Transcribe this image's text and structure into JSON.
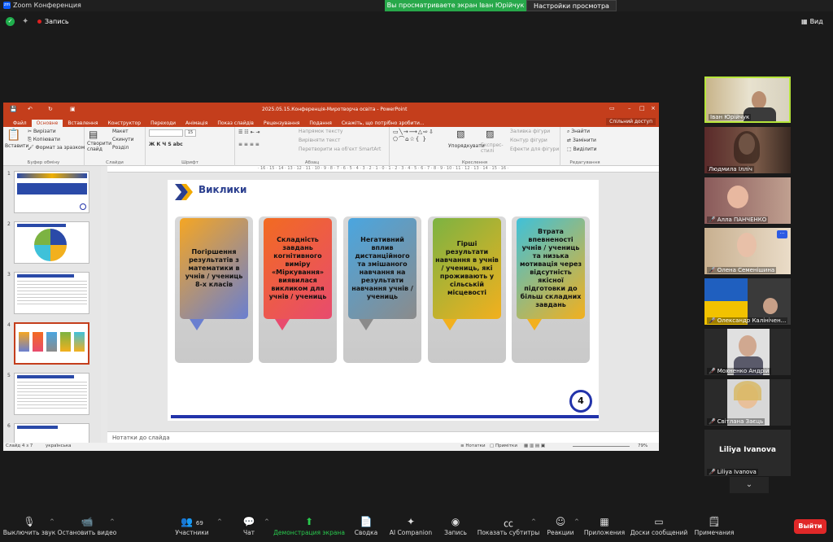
{
  "zoom": {
    "title": "Zoom Конференция",
    "logo_text": "zm",
    "share_banner": "Вы просматриваете экран Іван Юрійчук",
    "view_options": "Настройки просмотра",
    "record_label": "Запись",
    "view_label": "Вид"
  },
  "ppt": {
    "window_title": "2025.05.15.Конференція-Миротворча освіта - PowerPoint",
    "tabs": [
      "Файл",
      "Основне",
      "Вставлення",
      "Конструктор",
      "Переходи",
      "Анімація",
      "Показ слайдів",
      "Рецензування",
      "Подання",
      "Скажіть, що потрібно зробити..."
    ],
    "share": "Спільний доступ",
    "ribbon": {
      "paste": "Вставити",
      "cut": "Вирізати",
      "copy": "Копіювати",
      "format_painter": "Формат за зразком",
      "clipboard_group": "Буфер обміну",
      "new_slide": "Створити слайд",
      "layout": "Макет",
      "reset": "Скинути",
      "section": "Розділ",
      "slides_group": "Слайди",
      "font_size": "15",
      "font_group": "Шрифт",
      "text_direction": "Напрямок тексту",
      "align_text": "Вирівняти текст",
      "smartart": "Перетворити на об'єкт SmartArt",
      "paragraph_group": "Абзац",
      "arrange": "Упорядкувати",
      "quick_styles": "Експрес-стилі",
      "shape_fill": "Заливка фігури",
      "shape_outline": "Контур фігури",
      "shape_effects": "Ефекти для фігури",
      "drawing_group": "Креслення",
      "find": "Знайти",
      "replace": "Замінити",
      "select": "Виділити",
      "editing_group": "Редагування"
    },
    "ruler": "· 16 · 15 · 14 · 13 · 12 · 11 · 10 · 9 · 8 · 7 · 6 · 5 · 4 · 3 · 2 · 1 · 0 · 1 · 2 · 3 · 4 · 5 · 6 · 7 · 8 · 9 · 10 · 11 · 12 · 13 · 14 · 15 · 16 ·",
    "thumb_numbers": [
      "1",
      "2",
      "3",
      "4",
      "5",
      "6"
    ],
    "notes": "Нотатки до слайда",
    "status": {
      "slide": "Слайд 4 з 7",
      "language": "українська",
      "notes": "Нотатки",
      "comments": "Примітки",
      "zoom": "79%"
    }
  },
  "slide": {
    "title": "Виклики",
    "page": "4",
    "cards": [
      {
        "text": "Погіршення результатів з математики в учнів / учениць 8-х класів"
      },
      {
        "text": "Складність завдань когнітивного виміру «Міркування» виявилася викликом для учнів / учениць"
      },
      {
        "text": "Негативний вплив дистанційного та змішаного навчання на результати навчання учнів / учениць"
      },
      {
        "text": "Гірші результати навчання в учнів / учениць, які проживають у сільській місцевості"
      },
      {
        "text": "Втрата впевненості учнів / учениць та низька мотивація через відсутність якісної підготовки до більш складних завдань"
      }
    ],
    "colors": {
      "card1": [
        "#f5a623",
        "#6a7fd0"
      ],
      "card2": [
        "#f26b21",
        "#e84b6e"
      ],
      "card3": [
        "#4aa6e0",
        "#8b8b8b"
      ],
      "card4": [
        "#7cb342",
        "#f2b01e"
      ],
      "card5": [
        "#3fc1d9",
        "#f2b01e"
      ],
      "accent": "#2233aa"
    }
  },
  "participants": [
    {
      "name": "Іван Юрійчук",
      "active": true,
      "muted": false
    },
    {
      "name": "Людмила Ілліч",
      "muted": false
    },
    {
      "name": "Алла ПАНЧЕНКО",
      "muted": true
    },
    {
      "name": "Олена Семенішина",
      "muted": true
    },
    {
      "name": "Олександр Калінічен...",
      "muted": true
    },
    {
      "name": "Мохненко Андрій",
      "muted": true
    },
    {
      "name": "Світлана Заєць",
      "muted": true
    },
    {
      "name": "Liliya Ivanova",
      "label": "Liliya Ivanova",
      "muted": true
    }
  ],
  "bottom": {
    "mute": "Выключить звук",
    "video": "Остановить видео",
    "participants": "Участники",
    "participants_count": "69",
    "chat": "Чат",
    "share": "Демонстрация экрана",
    "summary": "Сводка",
    "ai": "AI Companion",
    "record": "Запись",
    "captions": "Показать субтитры",
    "reactions": "Реакции",
    "apps": "Приложения",
    "whiteboards": "Доски сообщений",
    "notes": "Примечания",
    "leave": "Выйти"
  }
}
